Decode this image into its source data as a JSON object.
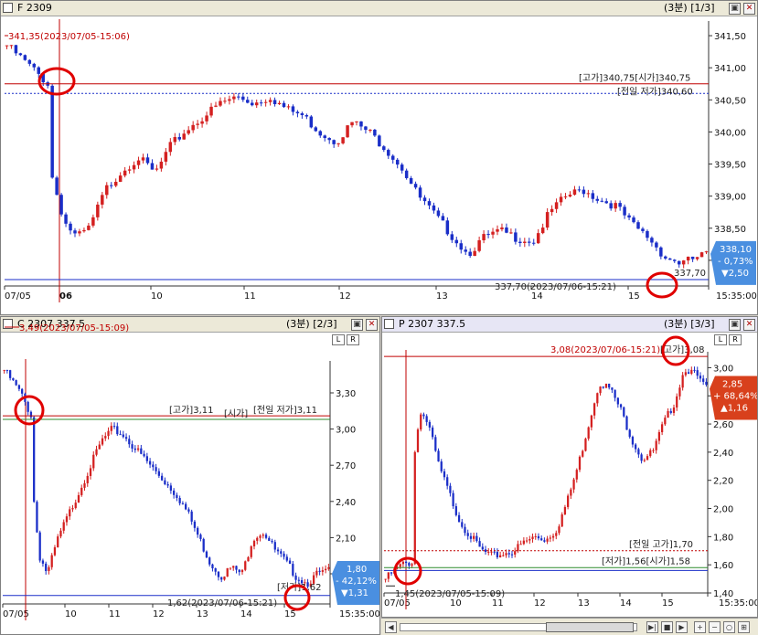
{
  "colors": {
    "up": "#d42020",
    "down": "#1a2ec8",
    "ref_red": "#c00000",
    "ref_blue": "#1a2ec8",
    "ref_green": "#2e8b2e",
    "marker": "#e00000",
    "badge_blue": "#4a8fe0",
    "badge_red": "#d8401c"
  },
  "icons": {
    "restore": "restore-icon",
    "close": "close-icon",
    "left": "left-arrow-icon",
    "right": "right-arrow-icon",
    "zoom_in": "zoom-in-icon",
    "zoom_out": "zoom-out-icon"
  },
  "panels": {
    "f": {
      "title": "F 2309",
      "counter": "(3분) [1/3]"
    },
    "c": {
      "title": "C 2307 337.5",
      "counter": "(3분) [2/3]"
    },
    "p": {
      "title": "P 2307 337.5",
      "counter": "(3분) [3/3]"
    }
  },
  "lb": {
    "l": "L",
    "r": "R"
  },
  "chart_data": [
    {
      "type": "candlestick",
      "title": "F 2309",
      "ylim": [
        337.6,
        341.7
      ],
      "yticks": [
        "341,50",
        "341,00",
        "340,50",
        "340,00",
        "339,50",
        "339,00",
        "338,50",
        "338,00"
      ],
      "ytick_values": [
        341.5,
        341.0,
        340.5,
        340.0,
        339.5,
        339.0,
        338.5,
        338.0
      ],
      "xtick_labels": [
        "07/05",
        "06",
        "10",
        "11",
        "12",
        "13",
        "14",
        "15",
        "15:35:00"
      ],
      "annotations": {
        "high_label": "341,35(2023/07/05-15:06)",
        "low_label": "337,70(2023/07/06-15:21)",
        "ref1": "[고가]340,75[시가]340,75",
        "ref2": "[전일 저가]340,60",
        "low_tag": "337,70"
      },
      "levels": {
        "high": 340.75,
        "prev_low": 340.6,
        "low": 337.7,
        "high_mark": 341.35
      },
      "current": {
        "price": "338,10",
        "pct": "- 0,73%",
        "chg": "▼2,50",
        "value": 338.1
      },
      "path": [
        [
          0,
          341.35
        ],
        [
          6,
          341.0
        ],
        [
          10,
          340.75
        ],
        [
          11,
          339.3
        ],
        [
          14,
          338.6
        ],
        [
          17,
          338.35
        ],
        [
          20,
          338.5
        ],
        [
          24,
          339.1
        ],
        [
          28,
          339.4
        ],
        [
          32,
          339.6
        ],
        [
          36,
          339.35
        ],
        [
          40,
          339.8
        ],
        [
          44,
          340.05
        ],
        [
          48,
          340.25
        ],
        [
          52,
          340.45
        ],
        [
          56,
          340.55
        ],
        [
          60,
          340.45
        ],
        [
          64,
          340.55
        ],
        [
          68,
          340.35
        ],
        [
          72,
          340.25
        ],
        [
          76,
          340.0
        ],
        [
          80,
          339.85
        ],
        [
          84,
          340.15
        ],
        [
          88,
          340.0
        ],
        [
          92,
          339.75
        ],
        [
          96,
          339.45
        ],
        [
          100,
          339.0
        ],
        [
          104,
          338.7
        ],
        [
          108,
          338.4
        ],
        [
          112,
          338.1
        ],
        [
          116,
          338.35
        ],
        [
          120,
          338.45
        ],
        [
          124,
          338.35
        ],
        [
          128,
          338.3
        ],
        [
          132,
          338.75
        ],
        [
          136,
          339.0
        ],
        [
          140,
          339.1
        ],
        [
          144,
          338.95
        ],
        [
          148,
          338.85
        ],
        [
          152,
          338.55
        ],
        [
          156,
          338.35
        ],
        [
          160,
          338.05
        ],
        [
          164,
          337.95
        ],
        [
          168,
          338.05
        ],
        [
          170,
          338.1
        ]
      ]
    },
    {
      "type": "candlestick",
      "title": "C 2307 337.5",
      "ylim": [
        1.55,
        3.55
      ],
      "yticks": [
        "3,30",
        "3,00",
        "2,70",
        "2,40",
        "2,10",
        "1,80"
      ],
      "ytick_values": [
        3.3,
        3.0,
        2.7,
        2.4,
        2.1,
        1.8
      ],
      "xtick_labels": [
        "07/05",
        "10",
        "11",
        "12",
        "13",
        "14",
        "15",
        "15:35:00"
      ],
      "annotations": {
        "high_label": "3,49(2023/07/05-15:09)",
        "low_label": "1,62(2023/07/06-15:21)",
        "ref1": "[고가]3,11",
        "ref2": "[시가]",
        "ref3": "[전일 저가]3,11",
        "low_tag": "[저가]1,62"
      },
      "levels": {
        "high": 3.11,
        "prev_low": 3.08,
        "low": 1.62,
        "high_mark": 3.49
      },
      "current": {
        "price": "1,80",
        "pct": "- 42,12%",
        "chg": "▼1,31",
        "value": 1.8
      },
      "path": [
        [
          0,
          3.49
        ],
        [
          6,
          3.3
        ],
        [
          10,
          3.11
        ],
        [
          11,
          2.4
        ],
        [
          13,
          1.95
        ],
        [
          16,
          1.8
        ],
        [
          20,
          2.1
        ],
        [
          24,
          2.3
        ],
        [
          28,
          2.5
        ],
        [
          32,
          2.7
        ],
        [
          36,
          2.9
        ],
        [
          40,
          3.0
        ],
        [
          44,
          2.95
        ],
        [
          48,
          2.85
        ],
        [
          52,
          2.75
        ],
        [
          56,
          2.65
        ],
        [
          60,
          2.55
        ],
        [
          64,
          2.45
        ],
        [
          68,
          2.3
        ],
        [
          72,
          2.1
        ],
        [
          76,
          1.9
        ],
        [
          80,
          1.78
        ],
        [
          84,
          1.85
        ],
        [
          88,
          1.8
        ],
        [
          92,
          2.1
        ],
        [
          96,
          2.15
        ],
        [
          100,
          2.0
        ],
        [
          104,
          1.9
        ],
        [
          108,
          1.78
        ],
        [
          112,
          1.72
        ],
        [
          116,
          1.8
        ],
        [
          120,
          1.82
        ]
      ]
    },
    {
      "type": "candlestick",
      "title": "P 2307 337.5",
      "ylim": [
        1.4,
        3.1
      ],
      "yticks": [
        "3,00",
        "2,80",
        "2,60",
        "2,40",
        "2,20",
        "2,00",
        "1,80",
        "1,60",
        "1,40"
      ],
      "ytick_values": [
        3.0,
        2.8,
        2.6,
        2.4,
        2.2,
        2.0,
        1.8,
        1.6,
        1.4
      ],
      "xtick_labels": [
        "07/05",
        "10",
        "11",
        "12",
        "13",
        "14",
        "15",
        "15:35:00"
      ],
      "annotations": {
        "high_label": "3,08(2023/07/06-15:21)",
        "high_tag": "[고가]3,08",
        "low_label": "1,45(2023/07/05-15:09)",
        "ref1": "[전일 고가]1,70",
        "ref2": "[저가]1,56[시가]1,58"
      },
      "levels": {
        "high": 3.08,
        "prev_high": 1.7,
        "low": 1.56,
        "open": 1.58,
        "low_mark": 1.45
      },
      "current": {
        "price": "2,85",
        "pct": "+ 68,64%",
        "chg": "▲1,16",
        "value": 2.85
      },
      "path": [
        [
          0,
          1.5
        ],
        [
          6,
          1.6
        ],
        [
          10,
          1.62
        ],
        [
          11,
          2.4
        ],
        [
          13,
          2.7
        ],
        [
          16,
          2.6
        ],
        [
          20,
          2.3
        ],
        [
          24,
          2.1
        ],
        [
          28,
          1.9
        ],
        [
          32,
          1.8
        ],
        [
          36,
          1.7
        ],
        [
          40,
          1.66
        ],
        [
          44,
          1.68
        ],
        [
          48,
          1.7
        ],
        [
          52,
          1.76
        ],
        [
          56,
          1.8
        ],
        [
          60,
          1.78
        ],
        [
          64,
          1.85
        ],
        [
          68,
          2.05
        ],
        [
          72,
          2.3
        ],
        [
          76,
          2.6
        ],
        [
          80,
          2.9
        ],
        [
          84,
          2.85
        ],
        [
          88,
          2.7
        ],
        [
          92,
          2.5
        ],
        [
          96,
          2.35
        ],
        [
          100,
          2.4
        ],
        [
          104,
          2.6
        ],
        [
          108,
          2.75
        ],
        [
          112,
          3.0
        ],
        [
          116,
          2.95
        ],
        [
          120,
          2.85
        ]
      ]
    }
  ]
}
